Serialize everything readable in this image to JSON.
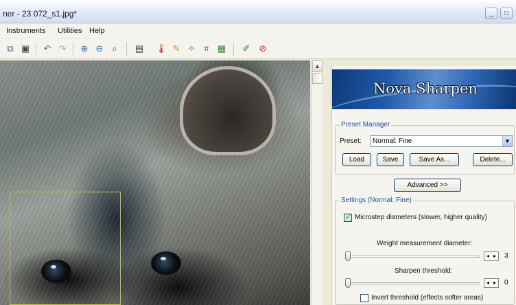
{
  "window": {
    "title": "ner - 23 072_s1.jpg*",
    "controls": {
      "minimize": "_",
      "maximize": "□"
    }
  },
  "menu": {
    "items": [
      "Instruments",
      "Utilities",
      "Help"
    ]
  },
  "toolbar": {
    "tools": [
      {
        "icon": "copy-icon",
        "glyph": "⧉",
        "color": "#3a5fb0"
      },
      {
        "icon": "paste-icon",
        "glyph": "▣",
        "color": "#444444"
      },
      {
        "icon": "undo-icon",
        "glyph": "↶",
        "color": "#5070b0"
      },
      {
        "icon": "redo-icon",
        "glyph": "↷",
        "color": "#9aa4b8"
      },
      {
        "icon": "zoom-in-icon",
        "glyph": "⊕",
        "color": "#2c6bb8"
      },
      {
        "icon": "zoom-out-icon",
        "glyph": "⊖",
        "color": "#2c6bb8"
      },
      {
        "icon": "zoom-fit-icon",
        "glyph": "⌕",
        "color": "#2c6bb8"
      },
      {
        "icon": "filmstrip-icon",
        "glyph": "▤",
        "color": "#333333"
      },
      {
        "icon": "thermometer-icon",
        "glyph": "🌡",
        "color": "#c02020"
      },
      {
        "icon": "brush-icon",
        "glyph": "✎",
        "color": "#c0a020"
      },
      {
        "icon": "sparkle-brush-icon",
        "glyph": "✧",
        "color": "#707070"
      },
      {
        "icon": "crop-icon",
        "glyph": "⌗",
        "color": "#2a4a8a"
      },
      {
        "icon": "image-icon",
        "glyph": "▦",
        "color": "#2d8a3a"
      },
      {
        "icon": "pencil-icon",
        "glyph": "✐",
        "color": "#2d8a3a"
      },
      {
        "icon": "stop-icon",
        "glyph": "⊘",
        "color": "#d01818"
      }
    ]
  },
  "scrollbar": {
    "up_glyph": "▲"
  },
  "panel": {
    "banner_title": "Nova Sharpen",
    "preset_manager": {
      "label": "Preset Manager",
      "preset_label": "Preset:",
      "preset_value": "Normal: Fine",
      "dropdown_glyph": "▼",
      "buttons": {
        "load": "Load",
        "save": "Save",
        "save_as": "Save As...",
        "delete": "Delete..."
      }
    },
    "advanced_button": "Advanced >>",
    "settings": {
      "label": "Settings (Normal: Fine)",
      "microstep": {
        "label": "Microstep diameters (slower, higher quality)",
        "checked": true
      },
      "weight": {
        "label": "Weight measurement diameter:",
        "value": "3",
        "left": "◂",
        "right": "▸",
        "position": 0
      },
      "threshold": {
        "label": "Sharpen threshold:",
        "value": "0",
        "left": "◂",
        "right": "▸",
        "position": 0
      },
      "invert": {
        "label": "Invert threshold (effects softer areas)",
        "checked": false
      }
    }
  }
}
